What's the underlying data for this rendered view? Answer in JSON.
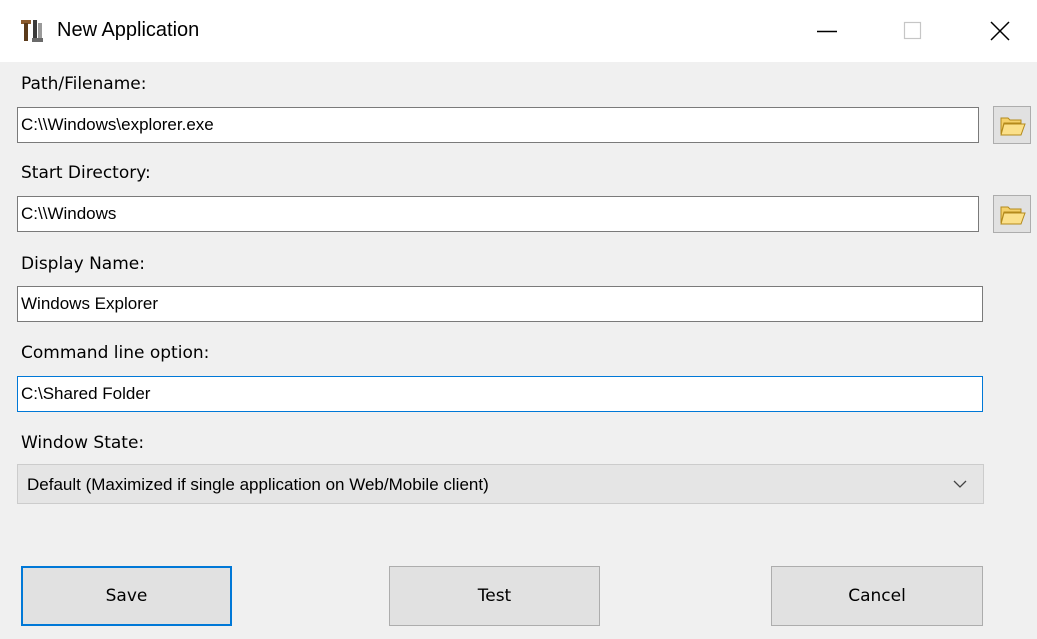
{
  "window": {
    "title": "New Application",
    "icon": "app-tools-icon"
  },
  "path": {
    "label": "Path/Filename:",
    "value": "C:\\\\Windows\\explorer.exe",
    "browse_icon": "folder-open-icon"
  },
  "start_dir": {
    "label": "Start Directory:",
    "value": "C:\\\\Windows",
    "browse_icon": "folder-open-icon"
  },
  "display_name": {
    "label": "Display Name:",
    "value": "Windows Explorer"
  },
  "cmdline": {
    "label": "Command line option:",
    "value": "C:\\Shared Folder"
  },
  "window_state": {
    "label": "Window State:",
    "selected": "Default (Maximized if single application on Web/Mobile client)"
  },
  "buttons": {
    "save": "Save",
    "test": "Test",
    "cancel": "Cancel"
  },
  "colors": {
    "accent": "#0078d7",
    "background": "#f0f0f0",
    "button": "#e1e1e1"
  }
}
